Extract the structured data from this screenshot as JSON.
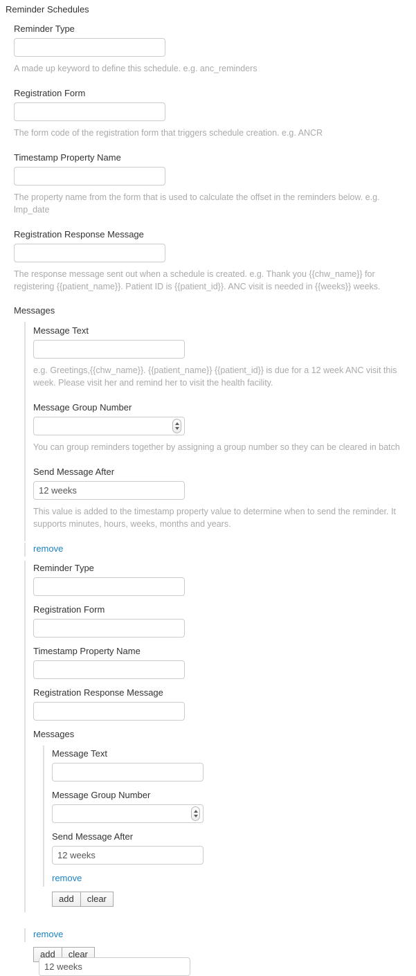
{
  "root": {
    "title": "Reminder Schedules"
  },
  "labels": {
    "reminder_type": "Reminder Type",
    "registration_form": "Registration Form",
    "timestamp_property": "Timestamp Property Name",
    "registration_response": "Registration Response Message",
    "messages": "Messages",
    "message_text": "Message Text",
    "message_group_number": "Message Group Number",
    "send_message_after": "Send Message After"
  },
  "help": {
    "reminder_type": "A made up keyword to define this schedule. e.g. anc_reminders",
    "registration_form": "The form code of the registration form that triggers schedule creation. e.g. ANCR",
    "timestamp_property": "The property name from the form that is used to calculate the offset in the reminders below. e.g. lmp_date",
    "registration_response": "The response message sent out when a schedule is created. e.g. Thank you {{chw_name}} for registering {{patient_name}}. Patient ID is {{patient_id}}. ANC visit is needed in {{weeks}} weeks.",
    "message_text": "e.g. Greetings,{{chw_name}}. {{patient_name}} {{patient_id}} is due for a 12 week ANC visit this week. Please visit her and remind her to visit the health facility.",
    "message_group_number": "You can group reminders together by assigning a group number so they can be cleared in batch",
    "send_message_after": "This value is added to the timestamp property value to determine when to send the reminder. It supports minutes, hours, weeks, months and years."
  },
  "values": {
    "reminder_type": "",
    "registration_form": "",
    "timestamp_property": "",
    "registration_response": "",
    "message_text": "",
    "message_group_number": "",
    "send_message_after": "12 weeks"
  },
  "actions": {
    "remove": "remove",
    "add": "add",
    "clear": "clear"
  },
  "colors": {
    "link": "#1a82c3",
    "label": "#333333",
    "help": "#aaaaac",
    "input_border": "#cccccc",
    "group_border": "#e0e0e0"
  }
}
